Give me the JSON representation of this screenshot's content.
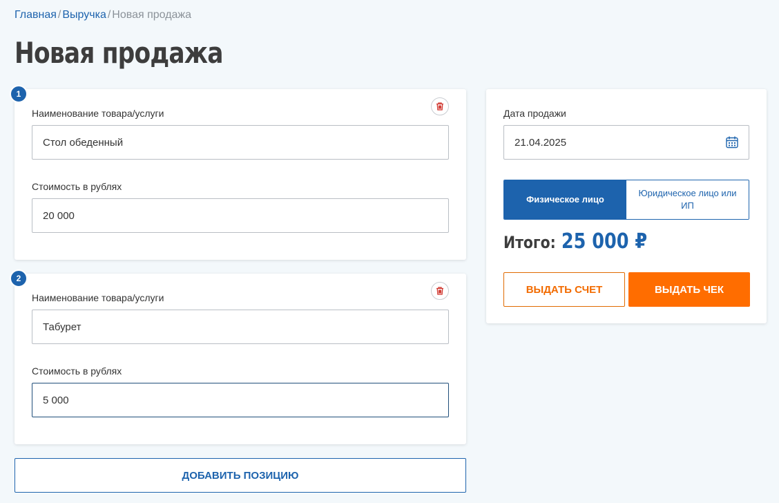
{
  "breadcrumb": {
    "home": "Главная",
    "revenue": "Выручка",
    "current": "Новая продажа",
    "separator": "/"
  },
  "page_title": "Новая продажа",
  "items": [
    {
      "number": "1",
      "name_label": "Наименование товара/услуги",
      "name_value": "Стол обеденный",
      "price_label": "Стоимость в рублях",
      "price_value": "20 000"
    },
    {
      "number": "2",
      "name_label": "Наименование товара/услуги",
      "name_value": "Табурет",
      "price_label": "Стоимость в рублях",
      "price_value": "5 000"
    }
  ],
  "add_position_label": "ДОБАВИТЬ ПОЗИЦИЮ",
  "sale": {
    "date_label": "Дата продажи",
    "date_value": "21.04.2025",
    "buyer_types": [
      "Физическое лицо",
      "Юридическое лицо или ИП"
    ],
    "selected_buyer_type": "Физическое лицо",
    "total_label": "Итого:",
    "total_value": "25 000 ₽",
    "invoice_label": "ВЫДАТЬ СЧЕТ",
    "check_label": "ВЫДАТЬ ЧЕК"
  },
  "colors": {
    "accent": "#1d63ad",
    "orange": "#ff6d00",
    "delete_icon": "#d0342c",
    "background": "#f3f8fb"
  },
  "icons": {
    "delete": "trash-icon",
    "calendar": "calendar-icon"
  }
}
